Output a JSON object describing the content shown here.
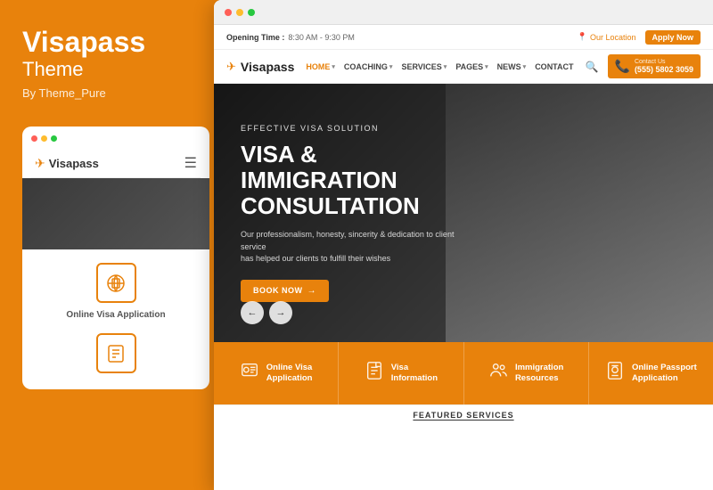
{
  "left": {
    "brand": {
      "title": "Visapass",
      "subtitle": "Theme",
      "by": "By Theme_Pure"
    },
    "mobile": {
      "logo_text": "Visapass",
      "feature_label": "Online Visa Application",
      "dots": [
        "red",
        "yellow",
        "green"
      ]
    }
  },
  "browser": {
    "topbar": {
      "opening_time_label": "Opening Time :",
      "opening_time_value": "8:30 AM - 9:30 PM",
      "location": "Our Location",
      "apply_btn": "Apply Now"
    },
    "nav": {
      "logo": "Visapass",
      "links": [
        "HOME",
        "COACHING",
        "SERVICES",
        "PAGES",
        "NEWS",
        "CONTACT"
      ],
      "contact_label": "Contact Us",
      "contact_phone": "(555) 5802 3059"
    },
    "hero": {
      "tagline": "EFFECTIVE VISA SOLUTION",
      "title_line1": "VISA & IMMIGRATION",
      "title_line2": "CONSULTATION",
      "description": "Our professionalism, honesty, sincerity & dedication to client service\nhas helped our clients to fulfill their wishes",
      "cta_btn": "BOOK NOW",
      "arrow_left": "←",
      "arrow_right": "→"
    },
    "features": [
      {
        "icon": "globe",
        "label": "Online Visa\nApplication"
      },
      {
        "icon": "doc",
        "label": "Visa\nInformation"
      },
      {
        "icon": "people",
        "label": "Immigration\nResources"
      },
      {
        "icon": "passport",
        "label": "Online Passport\nApplication"
      }
    ],
    "featured_services": "FEATURED SERVICES"
  }
}
